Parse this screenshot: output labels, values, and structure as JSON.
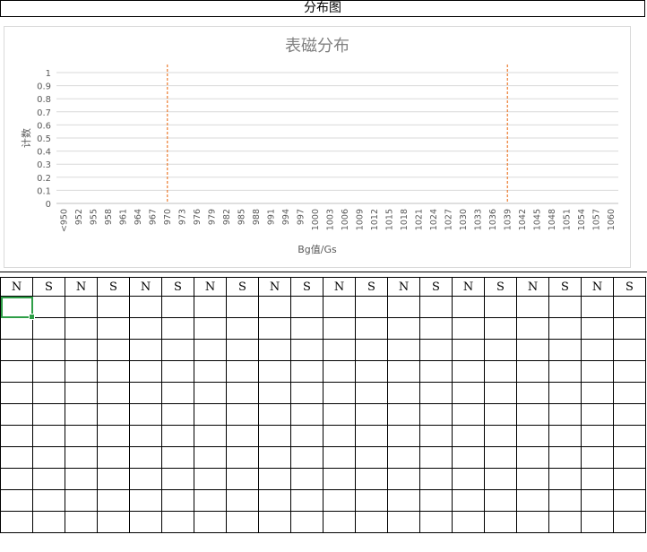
{
  "sheet": {
    "header_title": "分布图",
    "column_headers": [
      "N",
      "S",
      "N",
      "S",
      "N",
      "S",
      "N",
      "S",
      "N",
      "S",
      "N",
      "S",
      "N",
      "S",
      "N",
      "S",
      "N",
      "S",
      "N",
      "S"
    ],
    "empty_rows": 11,
    "selection_color": "#2e9e47"
  },
  "chart_data": {
    "type": "bar",
    "title": "表磁分布",
    "xlabel": "Bg值/Gs",
    "ylabel": "计数",
    "ylim": [
      0,
      1
    ],
    "yticks": [
      "0",
      "0.1",
      "0.2",
      "0.3",
      "0.4",
      "0.5",
      "0.6",
      "0.7",
      "0.8",
      "0.9",
      "1"
    ],
    "grid": true,
    "categories": [
      "<950",
      "952",
      "955",
      "958",
      "961",
      "964",
      "967",
      "970",
      "973",
      "976",
      "979",
      "982",
      "985",
      "988",
      "991",
      "994",
      "997",
      "1000",
      "1003",
      "1006",
      "1009",
      "1012",
      "1015",
      "1018",
      "1021",
      "1024",
      "1027",
      "1030",
      "1033",
      "1036",
      "1039",
      "1042",
      "1045",
      "1048",
      "1051",
      "1054",
      "1057",
      "1060"
    ],
    "values": [
      0,
      0,
      0,
      0,
      0,
      0,
      0,
      0,
      0,
      0,
      0,
      0,
      0,
      0,
      0,
      0,
      0,
      0,
      0,
      0,
      0,
      0,
      0,
      0,
      0,
      0,
      0,
      0,
      0,
      0,
      0,
      0,
      0,
      0,
      0,
      0,
      0,
      0
    ],
    "reference_lines": [
      {
        "at_category": "970",
        "color": "#ed7d31"
      },
      {
        "at_category": "1039",
        "color": "#ed7d31"
      }
    ],
    "title_color": "#808080",
    "axis_text_color": "#595959",
    "grid_color": "#d9d9d9"
  }
}
